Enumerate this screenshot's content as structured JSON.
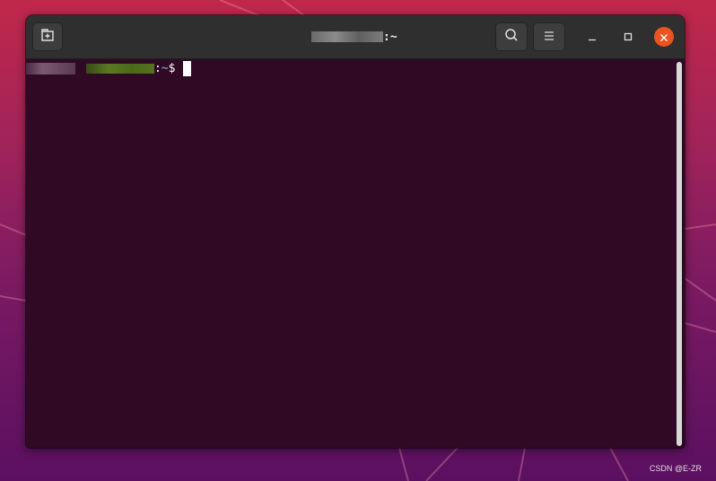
{
  "window": {
    "title_suffix": ":~"
  },
  "terminal": {
    "prompt_colon": ":",
    "prompt_path": "~",
    "prompt_symbol": "$"
  },
  "header": {
    "new_tab_icon": "new-tab-icon",
    "search_icon": "search-icon",
    "menu_icon": "hamburger-menu-icon",
    "minimize_icon": "minimize-icon",
    "maximize_icon": "maximize-icon",
    "close_icon": "close-icon"
  },
  "colors": {
    "terminal_bg": "#300a24",
    "headerbar_bg": "#2f2f2f",
    "close_button": "#e95420",
    "path_color": "#6b8fd8"
  },
  "watermark": "CSDN @E-ZR"
}
